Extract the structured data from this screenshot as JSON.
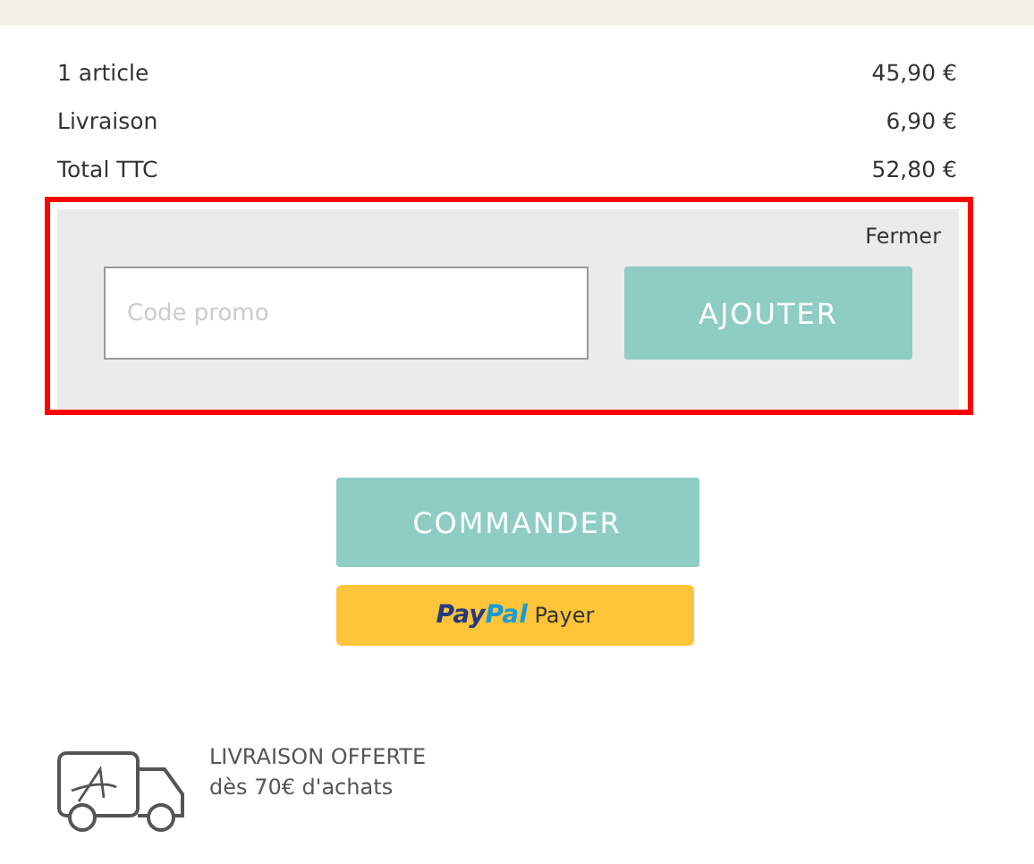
{
  "summary": [
    {
      "label": "1 article",
      "amount": "45,90 €"
    },
    {
      "label": "Livraison",
      "amount": "6,90 €"
    },
    {
      "label": "Total TTC",
      "amount": "52,80 €"
    }
  ],
  "promo": {
    "highlighted": true,
    "close": "Fermer",
    "placeholder": "Code promo",
    "button": "AJOUTER"
  },
  "checkout_button": "COMMANDER",
  "paypal": {
    "logo_parts": [
      "Pay",
      "Pal"
    ],
    "label": "Payer"
  },
  "shipping": {
    "title": "LIVRAISON OFFERTE",
    "subtitle": "dès 70€ d'achats"
  }
}
